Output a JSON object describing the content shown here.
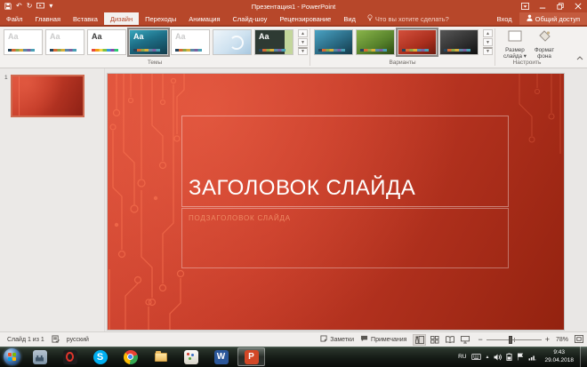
{
  "window": {
    "title": "Презентация1 - PowerPoint"
  },
  "header": {
    "tabs": [
      "Файл",
      "Главная",
      "Вставка",
      "Дизайн",
      "Переходы",
      "Анимация",
      "Слайд-шоу",
      "Рецензирование",
      "Вид"
    ],
    "active_tab": "Дизайн",
    "tellme": "Что вы хотите сделать?",
    "sign_in": "Вход",
    "share": "Общий доступ"
  },
  "ribbon": {
    "themes": {
      "label": "Темы",
      "aa": "Aa"
    },
    "variants": {
      "label": "Варианты"
    },
    "customize": {
      "label": "Настроить",
      "slide_size": "Размер слайда ▾",
      "format_bg": "Формат фона"
    }
  },
  "glyphs": {
    "undo": "↶",
    "redo": "↻",
    "dropdown": "▾",
    "scroll_up": "▲",
    "scroll_down": "▼",
    "tray_expand": "▲"
  },
  "slides_panel": {
    "slide_number": "1"
  },
  "slide": {
    "title": "ЗАГОЛОВОК СЛАЙДА",
    "subtitle": "ПОДЗАГОЛОВОК СЛАЙДА"
  },
  "status_bar": {
    "slide_info": "Слайд 1 из 1",
    "language": "русский",
    "notes": "Заметки",
    "comments": "Примечания",
    "zoom_minus": "−",
    "zoom_plus": "+",
    "zoom_level": "78%"
  },
  "taskbar": {
    "lang": "RU",
    "time": "9:43",
    "date": "29.04.2018",
    "apps": [
      "start",
      "security",
      "opera",
      "skype",
      "chrome",
      "explorer",
      "paint",
      "word",
      "powerpoint"
    ],
    "word_letter": "W",
    "ppt_letter": "P",
    "skype_letter": "S"
  },
  "colors": {
    "accent": "#b7472a",
    "slide_red": "#c43a27",
    "subtitle_orange": "#ef8a64",
    "selected_variant": "red"
  }
}
